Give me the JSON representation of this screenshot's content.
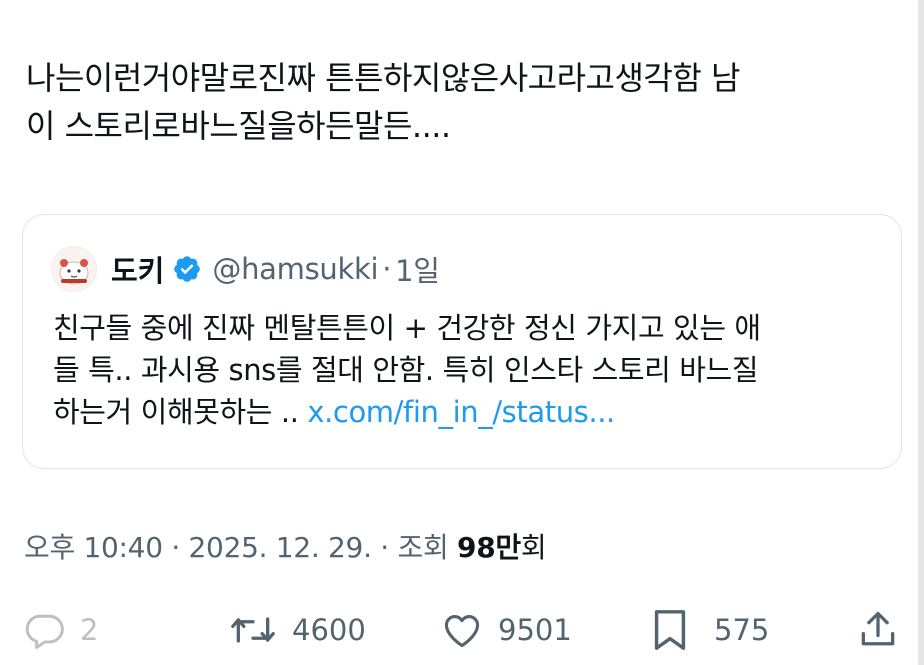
{
  "tweet": {
    "text_lines": [
      "나는이런거야말로진짜 튼튼하지않은사고라고생각함 남",
      "이 스토리로바느질을하든말든...."
    ]
  },
  "quote": {
    "name": "도키",
    "handle": "@hamsukki",
    "separator": "·",
    "time": "1일",
    "body_lines": [
      "친구들 중에 진짜 멘탈튼튼이 + 건강한 정신 가지고 있는 애",
      "들 특.. 과시용 sns를 절대 안함. 특히 인스타 스토리 바느질"
    ],
    "body_last_prefix": "하는거 이해못하는 .. ",
    "body_link": "x.com/fin_in_/status...",
    "avatar_icon": "hamster-avatar-icon",
    "verified_icon": "verified-badge-icon",
    "verified_color": "#1d9bf0"
  },
  "meta": {
    "time": "오후 10:40",
    "separator": "·",
    "date": "2025. 12. 29.",
    "views_label": "조회",
    "views_value": "98만",
    "views_suffix": "회"
  },
  "actions": {
    "reply_count": "2",
    "retweet_count": "4600",
    "like_count": "9501",
    "bookmark_count": "575"
  },
  "colors": {
    "text": "#0f1419",
    "secondary": "#536471",
    "link": "#1d9bf0",
    "border": "#e1e5e8"
  }
}
